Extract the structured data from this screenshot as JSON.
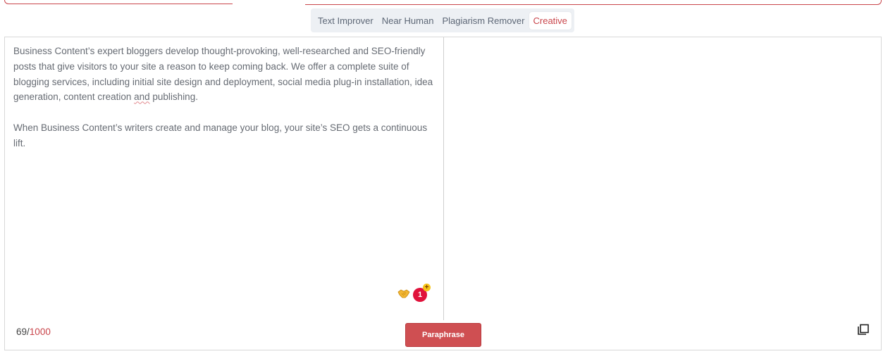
{
  "modes": {
    "tabs": [
      {
        "label": "Text Improver"
      },
      {
        "label": "Near Human"
      },
      {
        "label": "Plagiarism Remover"
      },
      {
        "label": "Creative"
      }
    ],
    "active": "Creative"
  },
  "input": {
    "paragraph1_before": "Business Content’s expert bloggers develop thought-provoking, well-researched and SEO-friendly posts that give visitors to your site a reason to keep coming back. We offer a complete suite of blogging services, including initial site design and deployment, social media plug-in installation, idea generation, content creation ",
    "paragraph1_flagged": "and",
    "paragraph1_after": " publishing.",
    "paragraph2": "When Business Content’s writers create and manage your blog, your site’s SEO gets a continuous lift."
  },
  "extensions": {
    "handshake_icon": "handshake-icon",
    "badge_count": "1",
    "badge_plus": "+"
  },
  "counter": {
    "current": "69",
    "separator": "/",
    "max": "1000"
  },
  "actions": {
    "paraphrase_label": "Paraphrase",
    "copy_icon": "copy-icon"
  },
  "colors": {
    "accent": "#c9454b",
    "button": "#cf4f52"
  }
}
